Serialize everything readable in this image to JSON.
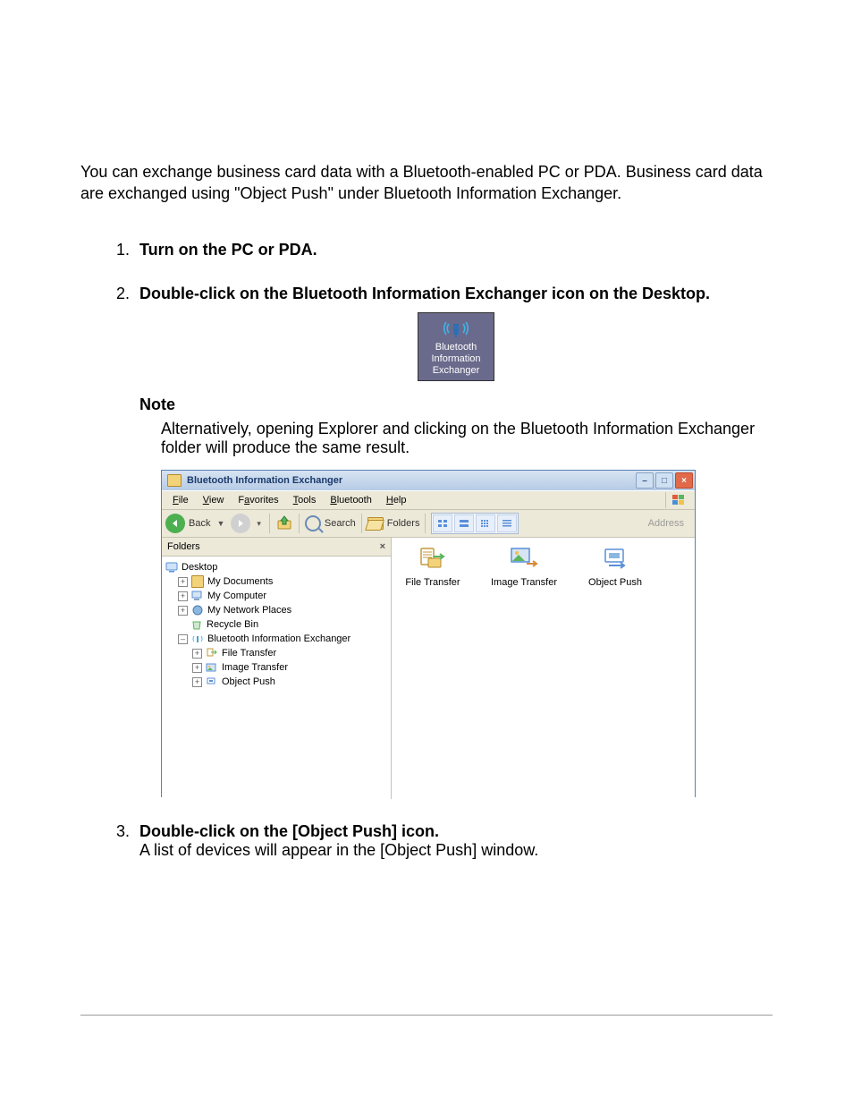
{
  "intro": "You can exchange business card data with a Bluetooth-enabled PC or PDA. Business card data are exchanged using \"Object Push\" under Bluetooth Information Exchanger.",
  "steps": {
    "s1": {
      "num": "1.",
      "title": "Turn on the PC or PDA."
    },
    "s2": {
      "num": "2.",
      "title": "Double-click on the Bluetooth Information Exchanger icon on the Desktop."
    },
    "s3": {
      "num": "3.",
      "title": "Double-click on the [Object Push] icon.",
      "body": "A list of devices will appear in the [Object Push] window."
    }
  },
  "note": {
    "label": "Note",
    "text": "Alternatively, opening Explorer and clicking on the Bluetooth Information Exchanger folder will produce the same result."
  },
  "icon": {
    "line1": "Bluetooth",
    "line2": "Information",
    "line3": "Exchanger"
  },
  "explorer": {
    "title": "Bluetooth Information Exchanger",
    "menus": {
      "file": "File",
      "view": "View",
      "favorites": "Favorites",
      "tools": "Tools",
      "bluetooth": "Bluetooth",
      "help": "Help"
    },
    "toolbar": {
      "back": "Back",
      "search": "Search",
      "folders": "Folders",
      "address": "Address"
    },
    "tree": {
      "header": "Folders",
      "desktop": "Desktop",
      "mydocs": "My Documents",
      "mycomp": "My Computer",
      "mynet": "My Network Places",
      "recycle": "Recycle Bin",
      "bie": "Bluetooth Information Exchanger",
      "ft": "File Transfer",
      "it": "Image Transfer",
      "op": "Object Push"
    },
    "content": {
      "ft": "File Transfer",
      "it": "Image Transfer",
      "op": "Object Push"
    }
  }
}
